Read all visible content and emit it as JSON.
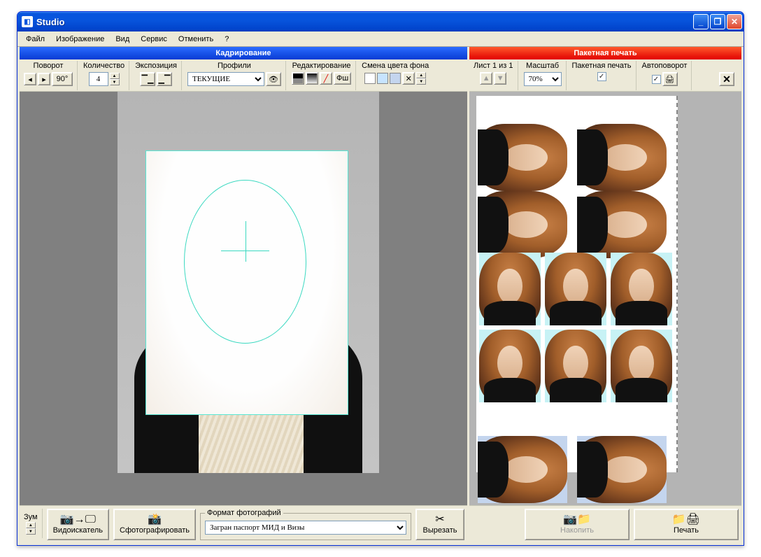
{
  "titlebar": {
    "app_name": "Studio"
  },
  "menu": {
    "file": "Файл",
    "image": "Изображение",
    "view": "Вид",
    "service": "Сервис",
    "undo": "Отменить",
    "help": "?"
  },
  "left": {
    "header": "Кадрирование",
    "rotate": {
      "label": "Поворот",
      "angle": "90°"
    },
    "qty": {
      "label": "Количество",
      "value": "4"
    },
    "exposure": {
      "label": "Экспозиция"
    },
    "profiles": {
      "label": "Профили",
      "value": "ТЕКУЩИЕ"
    },
    "editing": {
      "label": "Редактирование",
      "ps_label": "Фш"
    },
    "bgcolor": {
      "label": "Смена цвета фона"
    },
    "zoom": {
      "label": "Зум"
    },
    "viewfinder": "Видоискатель",
    "shoot": "Сфотографировать",
    "format_legend": "Формат фотографий",
    "format_value": "Загран паспорт МИД и Визы",
    "cut": "Вырезать"
  },
  "right": {
    "header": "Пакетная печать",
    "sheet": {
      "label": "Лист 1 из 1"
    },
    "scale": {
      "label": "Масштаб",
      "value": "70%"
    },
    "batch": {
      "label": "Пакетная печать",
      "checked": "✓"
    },
    "autorot": {
      "label": "Автоповорот",
      "checked": "✓"
    },
    "accumulate": "Накопить",
    "print": "Печать"
  },
  "colors": {
    "swatch1": "#ffffff",
    "swatch2": "#c7e4ff",
    "swatch3": "#c4d5ee"
  }
}
